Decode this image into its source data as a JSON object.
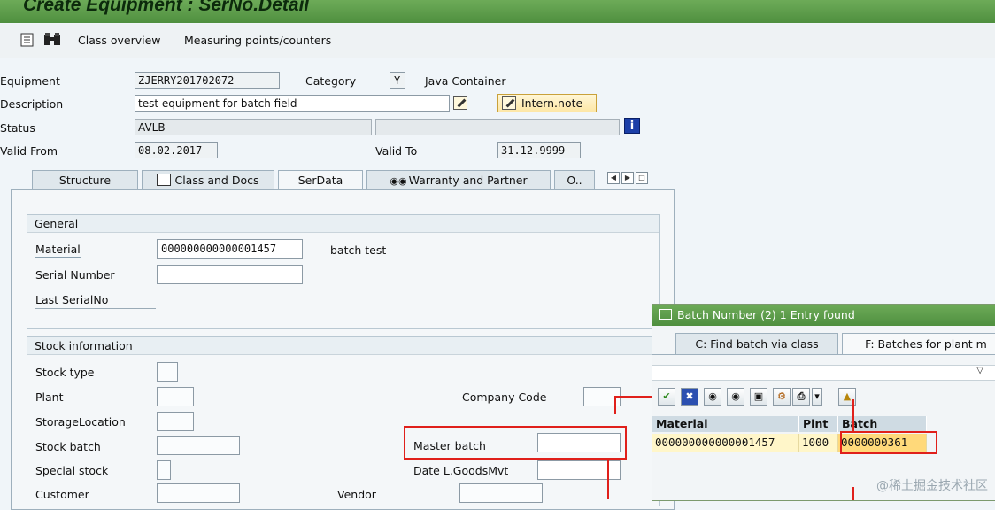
{
  "window": {
    "title": "Create Equipment : SerNo.Detail"
  },
  "toolbar": {
    "items": [
      "Class overview",
      "Measuring points/counters"
    ]
  },
  "header": {
    "equipment_label": "Equipment",
    "equipment_value": "ZJERRY201702072",
    "category_label": "Category",
    "category_value": "Y",
    "category_text": "Java Container",
    "description_label": "Description",
    "description_value": "test equipment for batch field",
    "intern_note": "Intern.note",
    "status_label": "Status",
    "status_value": "AVLB",
    "valid_from_label": "Valid From",
    "valid_from_value": "08.02.2017",
    "valid_to_label": "Valid To",
    "valid_to_value": "31.12.9999"
  },
  "tabs": [
    {
      "label": "Structure"
    },
    {
      "label": "Class and Docs"
    },
    {
      "label": "SerData",
      "active": true
    },
    {
      "label": "Warranty and Partner"
    },
    {
      "label": "O.."
    }
  ],
  "general": {
    "title": "General",
    "material_label": "Material",
    "material_value": "000000000000001457",
    "material_text": "batch test",
    "serial_label": "Serial Number",
    "serial_value": "",
    "last_serial_label": "Last SerialNo"
  },
  "stock": {
    "title": "Stock information",
    "stock_type_label": "Stock type",
    "plant_label": "Plant",
    "company_code_label": "Company Code",
    "storage_label": "StorageLocation",
    "stock_batch_label": "Stock batch",
    "master_batch_label": "Master batch",
    "special_stock_label": "Special stock",
    "date_label": "Date L.GoodsMvt",
    "customer_label": "Customer",
    "vendor_label": "Vendor"
  },
  "popup": {
    "title": "Batch Number (2)   1 Entry found",
    "tabs": [
      "C: Find batch via class",
      "F: Batches for plant m"
    ],
    "columns": [
      "Material",
      "Plnt",
      "Batch"
    ],
    "rows": [
      {
        "material": "000000000000001457",
        "plant": "1000",
        "batch": "0000000361"
      }
    ]
  },
  "watermark": "@稀土掘金技术社区",
  "colors": {
    "title_green": "#5a9a48",
    "highlight_red": "#e0201b",
    "row_yellow": "#fff6c9"
  }
}
